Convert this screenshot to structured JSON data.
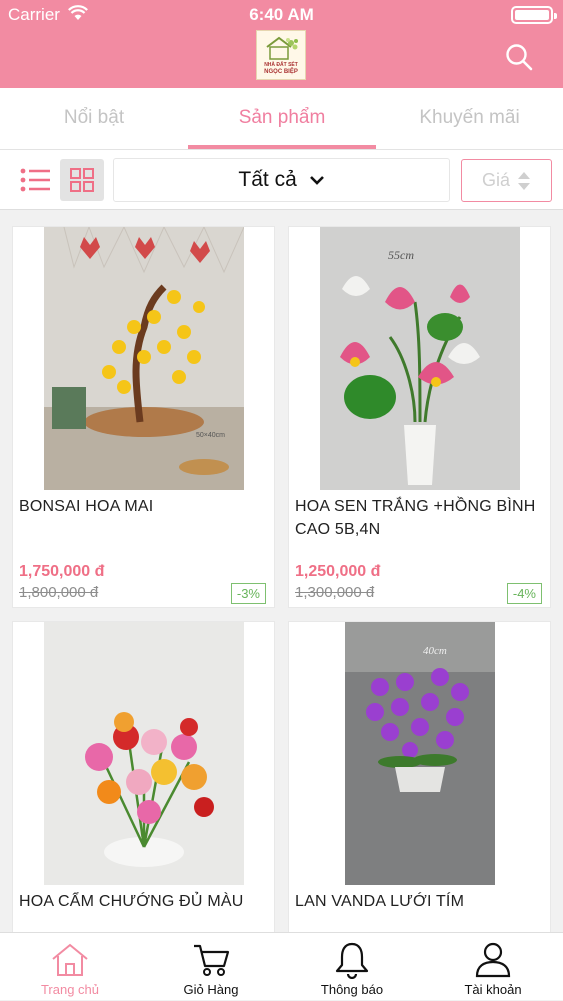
{
  "status_bar": {
    "carrier": "Carrier",
    "time": "6:40 AM"
  },
  "header": {
    "logo_text": [
      "NHÀ ĐẤT SÉT",
      "NGỌC BIỆP"
    ],
    "logo_icon": "clay-flower-logo",
    "search_icon": "search-icon",
    "background_color": "#f28ba2"
  },
  "tabs": [
    {
      "label": "Nổi bật",
      "active": false
    },
    {
      "label": "Sản phẩm",
      "active": true
    },
    {
      "label": "Khuyến mãi",
      "active": false
    }
  ],
  "toolbar": {
    "list_view_icon": "list-view-icon",
    "grid_view_icon": "grid-view-icon",
    "filter_value": "Tất cả",
    "price_sort_label": "Giá",
    "accent_color": "#ef6f86"
  },
  "products": [
    {
      "name": "BONSAI HOA MAI",
      "price": "1,750,000 đ",
      "old_price": "1,800,000 đ",
      "discount": "-3%",
      "photo_label": "50×40cm"
    },
    {
      "name": "HOA SEN TRẮNG +HỒNG BÌNH CAO 5B,4N",
      "price": "1,250,000 đ",
      "old_price": "1,300,000 đ",
      "discount": "-4%",
      "photo_label": "55cm"
    },
    {
      "name": "HOA CẨM CHƯỚNG ĐỦ MÀU",
      "price": "",
      "old_price": "",
      "discount": "",
      "photo_label": ""
    },
    {
      "name": "LAN VANDA LƯỚI TÍM",
      "price": "",
      "old_price": "",
      "discount": "",
      "photo_label": "40cm"
    }
  ],
  "bottom_nav": [
    {
      "label": "Trang chủ",
      "icon": "home-icon",
      "active": true
    },
    {
      "label": "Giỏ Hàng",
      "icon": "cart-icon",
      "active": false
    },
    {
      "label": "Thông báo",
      "icon": "bell-icon",
      "active": false
    },
    {
      "label": "Tài khoản",
      "icon": "user-icon",
      "active": false
    }
  ]
}
